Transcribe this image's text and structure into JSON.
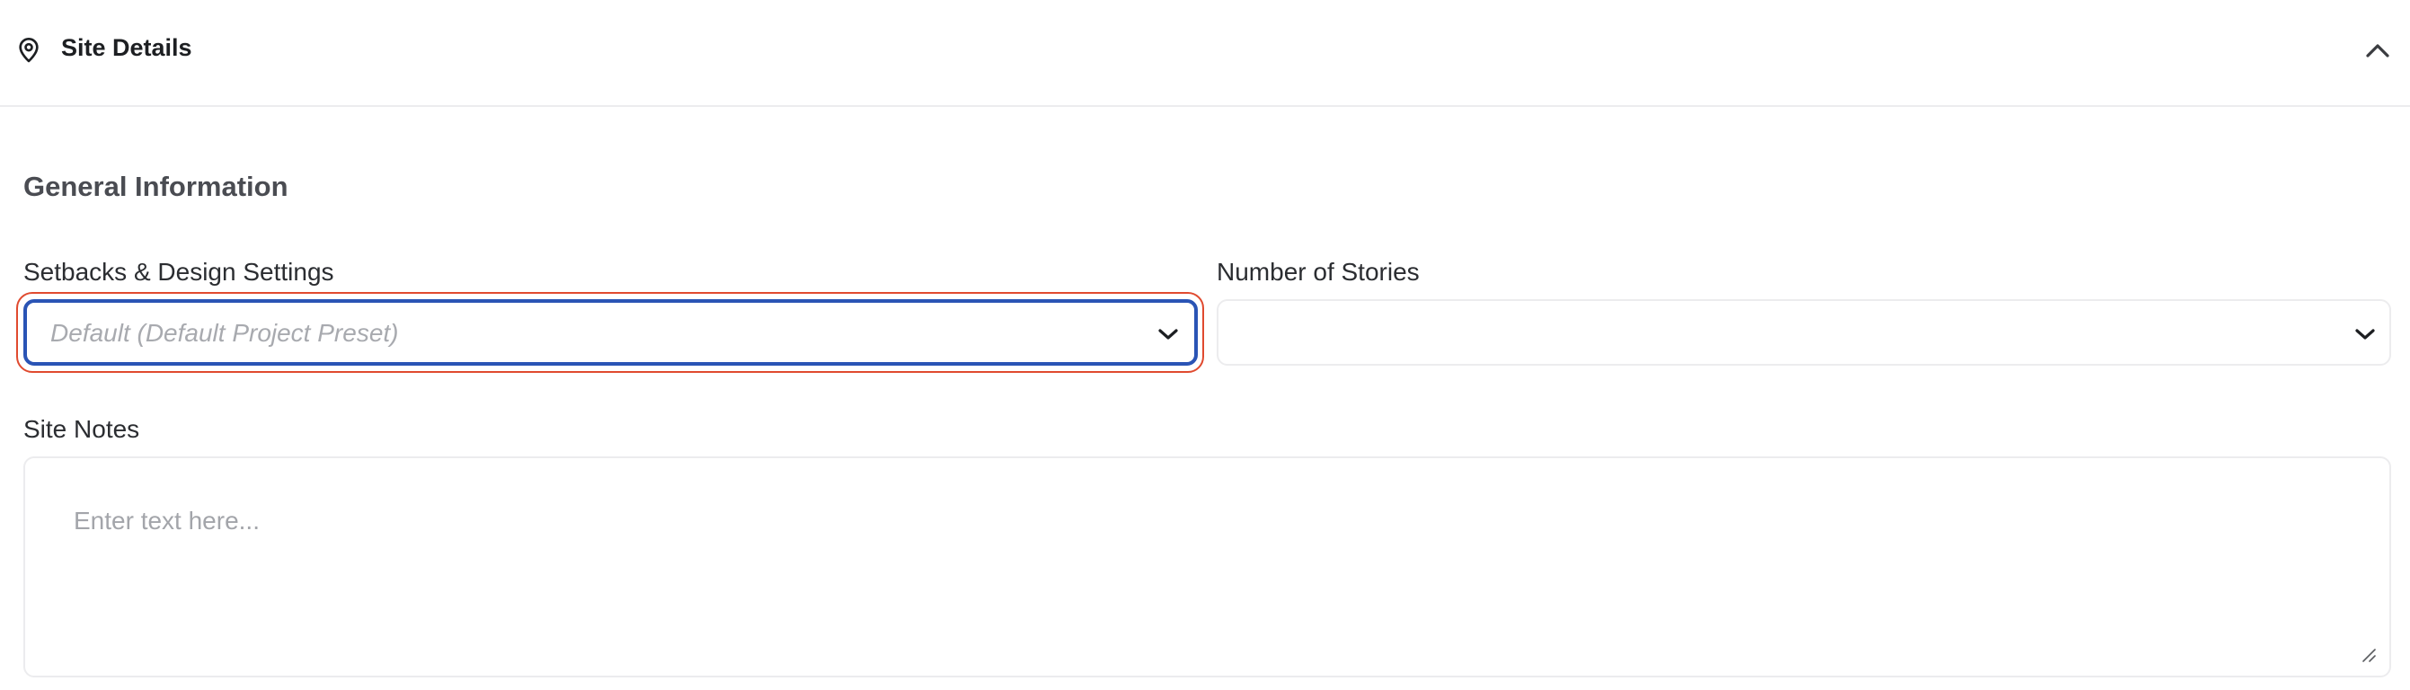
{
  "header": {
    "title": "Site Details",
    "icon": "map-pin-icon",
    "collapse_icon": "chevron-up-icon"
  },
  "section": {
    "title": "General Information"
  },
  "fields": {
    "setbacks": {
      "label": "Setbacks & Design Settings",
      "placeholder": "Default (Default Project Preset)",
      "value": "",
      "icon": "chevron-down-icon"
    },
    "stories": {
      "label": "Number of Stories",
      "value": "",
      "icon": "chevron-down-icon"
    },
    "notes": {
      "label": "Site Notes",
      "placeholder": "Enter text here...",
      "value": ""
    }
  },
  "colors": {
    "focus_border": "#2a54b5",
    "highlight_ring": "#e04a2f",
    "border": "#ececee",
    "placeholder": "#a8aaaf"
  }
}
